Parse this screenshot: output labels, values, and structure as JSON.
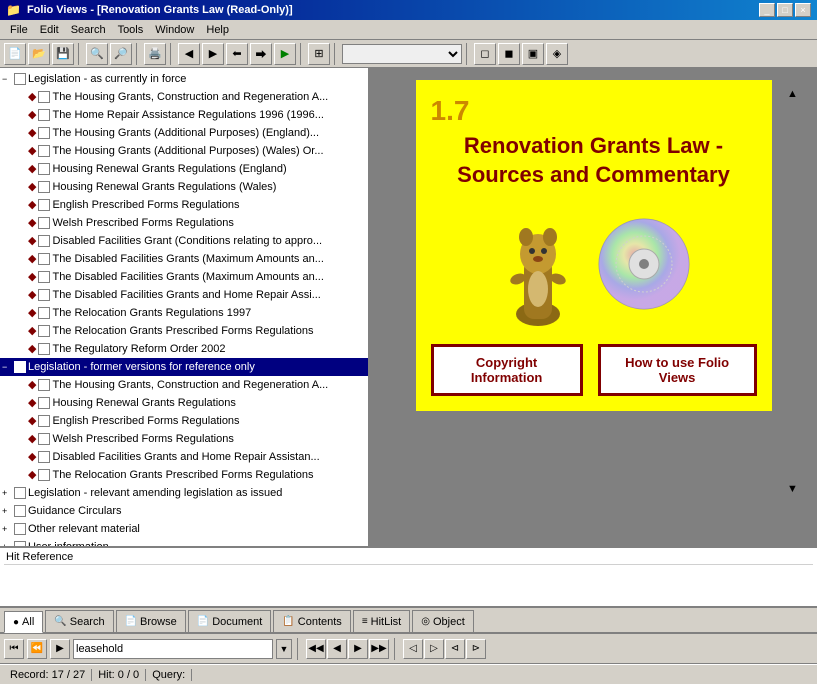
{
  "window": {
    "title": "Folio Views - [Renovation Grants Law  (Read-Only)]",
    "controls": [
      "_",
      "□",
      "×"
    ]
  },
  "menu": {
    "items": [
      "File",
      "Edit",
      "Search",
      "Tools",
      "Window",
      "Help"
    ]
  },
  "tree": {
    "items": [
      {
        "id": "leg-current",
        "level": 0,
        "expander": "−",
        "label": "Legislation - as currently in force",
        "selected": false
      },
      {
        "id": "item1",
        "level": 1,
        "expander": "",
        "label": "The Housing Grants, Construction and Regeneration A...",
        "selected": false
      },
      {
        "id": "item2",
        "level": 1,
        "expander": "",
        "label": "The Home Repair Assistance Regulations 1996 (1996...",
        "selected": false
      },
      {
        "id": "item3",
        "level": 1,
        "expander": "",
        "label": "The Housing Grants (Additional Purposes) (England)...",
        "selected": false
      },
      {
        "id": "item4",
        "level": 1,
        "expander": "",
        "label": "The Housing Grants (Additional Purposes) (Wales) Or...",
        "selected": false
      },
      {
        "id": "item5",
        "level": 1,
        "expander": "",
        "label": "Housing Renewal Grants Regulations (England)",
        "selected": false
      },
      {
        "id": "item6",
        "level": 1,
        "expander": "",
        "label": "Housing Renewal Grants Regulations (Wales)",
        "selected": false
      },
      {
        "id": "item7",
        "level": 1,
        "expander": "",
        "label": "English Prescribed Forms Regulations",
        "selected": false
      },
      {
        "id": "item8",
        "level": 1,
        "expander": "",
        "label": "Welsh Prescribed Forms Regulations",
        "selected": false
      },
      {
        "id": "item9",
        "level": 1,
        "expander": "",
        "label": "Disabled Facilities Grant (Conditions relating to appro...",
        "selected": false
      },
      {
        "id": "item10",
        "level": 1,
        "expander": "",
        "label": "The Disabled Facilities Grants (Maximum Amounts an...",
        "selected": false
      },
      {
        "id": "item11",
        "level": 1,
        "expander": "",
        "label": "The Disabled Facilities Grants (Maximum Amounts an...",
        "selected": false
      },
      {
        "id": "item12",
        "level": 1,
        "expander": "",
        "label": "The Disabled Facilities Grants and Home Repair Assi...",
        "selected": false
      },
      {
        "id": "item13",
        "level": 1,
        "expander": "",
        "label": "The Relocation Grants Regulations 1997",
        "selected": false
      },
      {
        "id": "item14",
        "level": 1,
        "expander": "",
        "label": "The Relocation Grants Prescribed Forms Regulations",
        "selected": false
      },
      {
        "id": "item15",
        "level": 1,
        "expander": "",
        "label": "The Regulatory Reform Order 2002",
        "selected": false
      },
      {
        "id": "leg-former",
        "level": 0,
        "expander": "−",
        "label": "Legislation - former versions for reference only",
        "selected": true
      },
      {
        "id": "fitem1",
        "level": 1,
        "expander": "",
        "label": "The Housing Grants, Construction and Regeneration A...",
        "selected": false
      },
      {
        "id": "fitem2",
        "level": 1,
        "expander": "",
        "label": "Housing Renewal Grants Regulations",
        "selected": false
      },
      {
        "id": "fitem3",
        "level": 1,
        "expander": "",
        "label": "English Prescribed Forms Regulations",
        "selected": false
      },
      {
        "id": "fitem4",
        "level": 1,
        "expander": "",
        "label": "Welsh Prescribed Forms Regulations",
        "selected": false
      },
      {
        "id": "fitem5",
        "level": 1,
        "expander": "",
        "label": "Disabled Facilities Grants and Home Repair Assistan...",
        "selected": false
      },
      {
        "id": "fitem6",
        "level": 1,
        "expander": "",
        "label": "The Relocation Grants Prescribed Forms Regulations",
        "selected": false
      },
      {
        "id": "leg-amend",
        "level": 0,
        "expander": "+",
        "label": "Legislation - relevant amending legislation as issued",
        "selected": false
      },
      {
        "id": "guidance",
        "level": 0,
        "expander": "+",
        "label": "Guidance Circulars",
        "selected": false
      },
      {
        "id": "other",
        "level": 0,
        "expander": "+",
        "label": "Other relevant material",
        "selected": false
      },
      {
        "id": "user",
        "level": 0,
        "expander": "+",
        "label": "User information",
        "selected": false
      }
    ]
  },
  "card": {
    "number": "1.7",
    "title": "Renovation Grants Law - Sources and Commentary",
    "btn_copyright": "Copyright Information",
    "btn_howto": "How to use Folio Views"
  },
  "hit_reference": {
    "label": "Hit Reference"
  },
  "tabs": [
    {
      "id": "all",
      "label": "All",
      "icon": "●",
      "active": true
    },
    {
      "id": "search",
      "label": "Search",
      "icon": "🔍",
      "active": false
    },
    {
      "id": "browse",
      "label": "Browse",
      "icon": "📄",
      "active": false
    },
    {
      "id": "document",
      "label": "Document",
      "icon": "📄",
      "active": false
    },
    {
      "id": "contents",
      "label": "Contents",
      "icon": "📋",
      "active": false
    },
    {
      "id": "hitlist",
      "label": "HitList",
      "icon": "≡",
      "active": false
    },
    {
      "id": "object",
      "label": "Object",
      "icon": "◎",
      "active": false
    }
  ],
  "bottom_toolbar": {
    "search_value": "leasehold",
    "search_placeholder": "leasehold"
  },
  "status_bar": {
    "record": "Record: 17 / 27",
    "hit": "Hit: 0 / 0",
    "query": "Query:"
  }
}
